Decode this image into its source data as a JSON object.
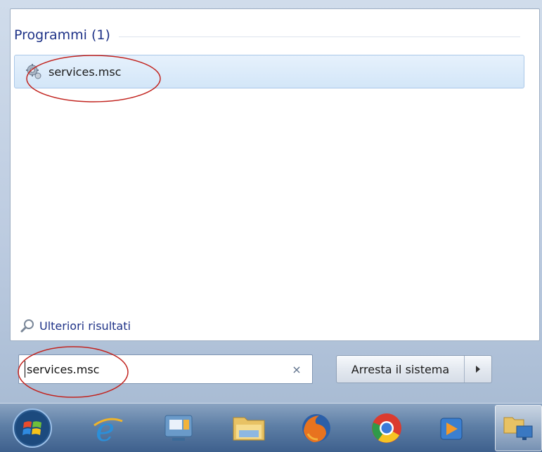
{
  "start_menu": {
    "section_title": "Programmi (1)",
    "results": [
      {
        "label": "services.msc",
        "icon": "services-gear-icon"
      }
    ],
    "more_results_label": "Ulteriori risultati",
    "search": {
      "value": "services.msc",
      "clear_symbol": "×"
    },
    "shutdown_label": "Arresta il sistema"
  },
  "taskbar": {
    "items": [
      {
        "name": "start-orb",
        "icon": "windows-orb-icon"
      },
      {
        "name": "internet-explorer",
        "icon": "internet-explorer-icon"
      },
      {
        "name": "windows-media-center",
        "icon": "media-center-icon"
      },
      {
        "name": "windows-explorer",
        "icon": "folder-icon"
      },
      {
        "name": "firefox",
        "icon": "firefox-icon"
      },
      {
        "name": "chrome",
        "icon": "chrome-icon"
      },
      {
        "name": "media-player",
        "icon": "media-player-icon"
      },
      {
        "name": "network",
        "icon": "network-icon"
      }
    ]
  },
  "colors": {
    "link_blue": "#1e3287",
    "highlight_bg": "#d3e6f8",
    "annotation_red": "#c2241f"
  }
}
